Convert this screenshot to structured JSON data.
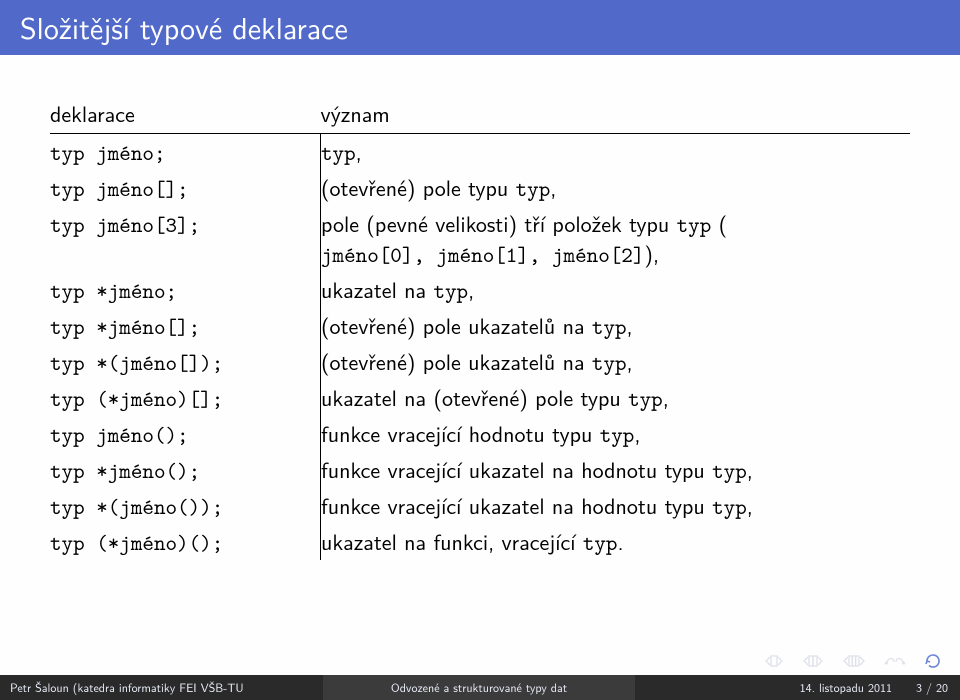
{
  "title": "Složitější typové deklarace",
  "table": {
    "head_left": "deklarace",
    "head_right": "význam",
    "rows": [
      {
        "decl": "typ jméno;",
        "mean_pre": "",
        "mean_tt1": "typ",
        "mean_post1": ",",
        "mean_tt2": "",
        "mean_post2": ""
      },
      {
        "decl": "typ jméno[];",
        "mean_pre": "(otevřené) pole typu ",
        "mean_tt1": "typ",
        "mean_post1": ",",
        "mean_tt2": "",
        "mean_post2": ""
      },
      {
        "decl": "typ jméno[3];",
        "mean_pre": "pole (pevné velikosti) tří položek typu ",
        "mean_tt1": "typ",
        "mean_post1": " (",
        "mean_tt2": "jméno[0], jméno[1], jméno[2]",
        "mean_post2": "),",
        "two_line": true
      },
      {
        "decl": "typ *jméno;",
        "mean_pre": "ukazatel na ",
        "mean_tt1": "typ",
        "mean_post1": ",",
        "mean_tt2": "",
        "mean_post2": ""
      },
      {
        "decl": "typ *jméno[];",
        "mean_pre": "(otevřené) pole ukazatelů na ",
        "mean_tt1": "typ",
        "mean_post1": ",",
        "mean_tt2": "",
        "mean_post2": ""
      },
      {
        "decl": "typ *(jméno[]);",
        "mean_pre": "(otevřené) pole ukazatelů na ",
        "mean_tt1": "typ",
        "mean_post1": ",",
        "mean_tt2": "",
        "mean_post2": ""
      },
      {
        "decl": "typ (*jméno)[];",
        "mean_pre": "ukazatel na (otevřené) pole typu ",
        "mean_tt1": "typ",
        "mean_post1": ",",
        "mean_tt2": "",
        "mean_post2": ""
      },
      {
        "decl": "typ jméno();",
        "mean_pre": "funkce vracející hodnotu typu ",
        "mean_tt1": "typ",
        "mean_post1": ",",
        "mean_tt2": "",
        "mean_post2": ""
      },
      {
        "decl": "typ *jméno();",
        "mean_pre": "funkce vracející ukazatel na hodnotu typu ",
        "mean_tt1": "typ",
        "mean_post1": ",",
        "mean_tt2": "",
        "mean_post2": ""
      },
      {
        "decl": "typ *(jméno());",
        "mean_pre": "funkce vracející ukazatel na hodnotu typu ",
        "mean_tt1": "typ",
        "mean_post1": ",",
        "mean_tt2": "",
        "mean_post2": ""
      },
      {
        "decl": "typ (*jméno)();",
        "mean_pre": "ukazatel na funkci, vracející ",
        "mean_tt1": "typ",
        "mean_post1": ".",
        "mean_tt2": "",
        "mean_post2": ""
      }
    ]
  },
  "footer": {
    "author": "Petr Šaloun (katedra informatiky FEI VŠB-TU",
    "talk": "Odvozené a strukturované typy dat",
    "date": "14. listopadu 2011",
    "page": "3 / 20"
  }
}
